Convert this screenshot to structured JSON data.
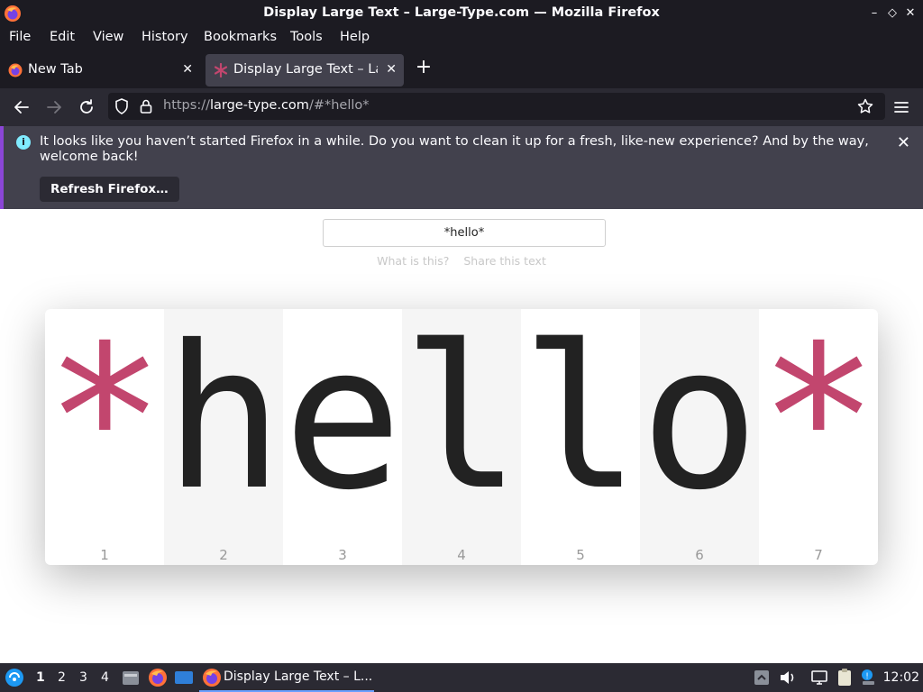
{
  "window": {
    "title": "Display Large Text – Large-Type.com — Mozilla Firefox",
    "controls": [
      "–",
      "◇",
      "✕"
    ]
  },
  "menubar": {
    "items": [
      "File",
      "Edit",
      "View",
      "History",
      "Bookmarks",
      "Tools",
      "Help"
    ]
  },
  "tabs": [
    {
      "label": "New Tab",
      "active": false,
      "icon": "firefox-icon"
    },
    {
      "label": "Display Large Text – Larg",
      "active": true,
      "icon": "asterisk-icon"
    }
  ],
  "navbar": {
    "url_prefix": "https://",
    "url_host": "large-type.com",
    "url_rest": "/#*hello*"
  },
  "notification": {
    "text": "It looks like you haven’t started Firefox in a while. Do you want to clean it up for a fresh, like-new experience? And by the way, welcome back!",
    "button": "Refresh Firefox…"
  },
  "page": {
    "input_value": "*hello*",
    "link_what": "What is this?",
    "link_share": "Share this text",
    "characters": [
      {
        "char": "*",
        "index": "1"
      },
      {
        "char": "h",
        "index": "2"
      },
      {
        "char": "e",
        "index": "3"
      },
      {
        "char": "l",
        "index": "4"
      },
      {
        "char": "l",
        "index": "5"
      },
      {
        "char": "o",
        "index": "6"
      },
      {
        "char": "*",
        "index": "7"
      }
    ],
    "symbol_color": "#c2466e"
  },
  "taskbar": {
    "workspaces": [
      "1",
      "2",
      "3",
      "4"
    ],
    "active_task": "Display Large Text – L...",
    "clock": "12:02"
  }
}
